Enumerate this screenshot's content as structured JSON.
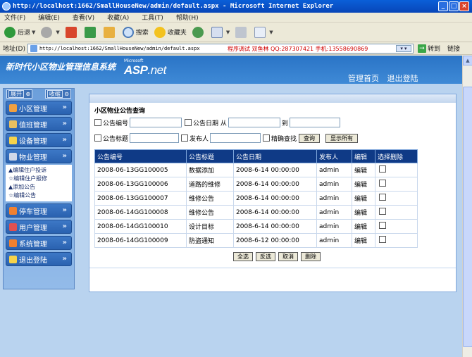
{
  "window": {
    "title": "http://localhost:1662/SmallHouseNew/admin/default.aspx - Microsoft Internet Explorer"
  },
  "menu": [
    "文件(F)",
    "编辑(E)",
    "查看(V)",
    "收藏(A)",
    "工具(T)",
    "帮助(H)"
  ],
  "toolbar": {
    "back": "后退",
    "search": "搜索",
    "favorites": "收藏夹"
  },
  "address": {
    "label": "地址(D)",
    "url": "http://localhost:1662/SmallHouseNew/admin/default.aspx",
    "promo": "程序调试 双鱼林 QQ:287307421 手机:13558690869",
    "go": "转到",
    "links": "链接"
  },
  "header": {
    "brand": "新时代小区物业管理信息系统",
    "asp_ms": "Microsoft",
    "asp_main": "ASP",
    "asp_net": ".net",
    "home_link": "管理首页",
    "logout_link": "退出登陆"
  },
  "sidebar": {
    "expand": "展开",
    "collapse": "收缩",
    "items": [
      {
        "label": "小区管理",
        "color": "#f0a040"
      },
      {
        "label": "值班管理",
        "color": "#e8c060"
      },
      {
        "label": "设备管理",
        "color": "#f6d34a"
      },
      {
        "label": "物业管理",
        "color": "#d0d8e8"
      },
      {
        "label": "停车管理",
        "color": "#f08030"
      },
      {
        "label": "用户管理",
        "color": "#e05050"
      },
      {
        "label": "系统管理",
        "color": "#f08030"
      },
      {
        "label": "退出登陆",
        "color": "#f6d34a"
      }
    ],
    "submenu": [
      "▲编辑住户投诉",
      "☆编辑住户报修",
      "▲添加公告",
      "☆编辑公告"
    ]
  },
  "panel": {
    "title": "小区物业公告查询",
    "filters": {
      "notice_no": "公告编号",
      "notice_date": "公告日期 从",
      "to": "到",
      "notice_title": "公告标题",
      "publisher": "发布人",
      "fuzzy": "精确查找",
      "query": "查询",
      "show_all": "显示所有"
    },
    "columns": [
      "公告编号",
      "公告标题",
      "公告日期",
      "发布人",
      "编辑",
      "选择删除"
    ],
    "rows": [
      {
        "id": "2008-06-13GG100005",
        "title": "数据添加",
        "date": "2008-6-14 00:00:00",
        "publisher": "admin",
        "edit": "编辑"
      },
      {
        "id": "2008-06-13GG100006",
        "title": "道路的维修",
        "date": "2008-6-14 00:00:00",
        "publisher": "admin",
        "edit": "编辑"
      },
      {
        "id": "2008-06-13GG100007",
        "title": "维修公告",
        "date": "2008-6-14 00:00:00",
        "publisher": "admin",
        "edit": "编辑"
      },
      {
        "id": "2008-06-14GG100008",
        "title": "维修公告",
        "date": "2008-6-14 00:00:00",
        "publisher": "admin",
        "edit": "编辑"
      },
      {
        "id": "2008-06-14GG100010",
        "title": "设计目标",
        "date": "2008-6-14 00:00:00",
        "publisher": "admin",
        "edit": "编辑"
      },
      {
        "id": "2008-06-14GG100009",
        "title": "防盗通知",
        "date": "2008-6-12 00:00:00",
        "publisher": "admin",
        "edit": "编辑"
      }
    ],
    "buttons": [
      "全选",
      "反选",
      "取消",
      "删除"
    ]
  }
}
